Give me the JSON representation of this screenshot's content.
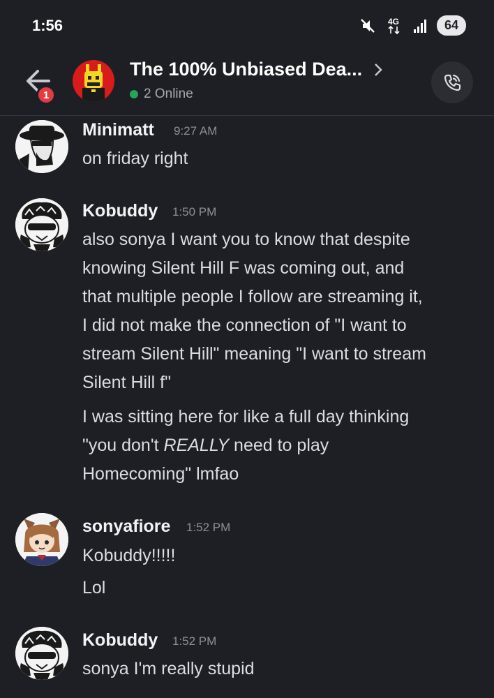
{
  "status_bar": {
    "time": "1:56",
    "network": "4G",
    "battery": "64"
  },
  "header": {
    "title": "The 100% Unbiased Dea...",
    "online": "2 Online",
    "unread_count": "1"
  },
  "messages": [
    {
      "author": "Minimatt",
      "time": "9:27 AM",
      "lines": [
        "on friday right"
      ]
    },
    {
      "author": "Kobuddy",
      "time": "1:50 PM",
      "lines": [
        "also sonya I want you to know that despite",
        "knowing Silent Hill F was coming out, and",
        "that multiple people I follow are streaming it,",
        "I did not make the connection of \"I want to",
        "stream Silent Hill\" meaning \"I want to stream",
        "Silent Hill f\""
      ],
      "followup": {
        "line1": "I was sitting here for like a full day thinking",
        "line2_pre": "\"you don't ",
        "line2_em": "REALLY",
        "line2_post": " need to play",
        "line3": "Homecoming\" lmfao"
      }
    },
    {
      "author": "sonyafiore",
      "time": "1:52 PM",
      "lines": [
        "Kobuddy!!!!!"
      ],
      "followup_line": "Lol"
    },
    {
      "author": "Kobuddy",
      "time": "1:52 PM",
      "lines": [
        "sonya I'm really stupid"
      ]
    }
  ],
  "colors": {
    "background": "#1e1f24",
    "online": "#23a55a",
    "badge": "#e23b44"
  }
}
